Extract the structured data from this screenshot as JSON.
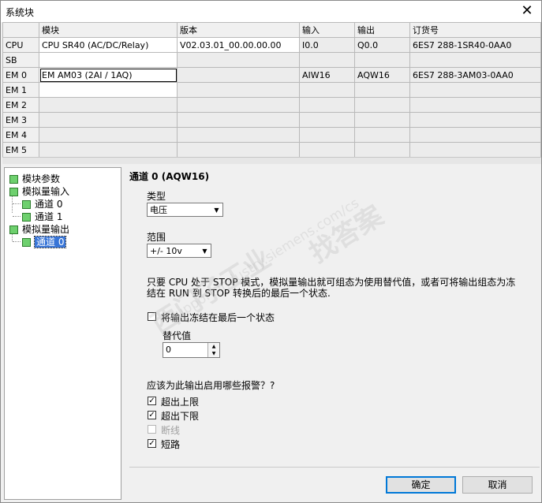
{
  "window": {
    "title": "系统块",
    "close_glyph": "✕"
  },
  "grid": {
    "headers": [
      "",
      "模块",
      "版本",
      "输入",
      "输出",
      "订货号"
    ],
    "rows": [
      {
        "slot": "CPU",
        "module": "CPU SR40 (AC/DC/Relay)",
        "version": "V02.03.01_00.00.00.00",
        "input": "I0.0",
        "output": "Q0.0",
        "order": "6ES7 288-1SR40-0AA0"
      },
      {
        "slot": "SB",
        "module": "",
        "version": "",
        "input": "",
        "output": "",
        "order": ""
      },
      {
        "slot": "EM 0",
        "module": "EM AM03 (2AI / 1AQ)",
        "version": "",
        "input": "AIW16",
        "output": "AQW16",
        "order": "6ES7 288-3AM03-0AA0"
      },
      {
        "slot": "EM 1",
        "module": "",
        "version": "",
        "input": "",
        "output": "",
        "order": ""
      },
      {
        "slot": "EM 2",
        "module": "",
        "version": "",
        "input": "",
        "output": "",
        "order": ""
      },
      {
        "slot": "EM 3",
        "module": "",
        "version": "",
        "input": "",
        "output": "",
        "order": ""
      },
      {
        "slot": "EM 4",
        "module": "",
        "version": "",
        "input": "",
        "output": "",
        "order": ""
      },
      {
        "slot": "EM 5",
        "module": "",
        "version": "",
        "input": "",
        "output": "",
        "order": ""
      }
    ]
  },
  "tree": {
    "module_params": "模块参数",
    "analog_input": "模拟量输入",
    "ai_ch0": "通道 0",
    "ai_ch1": "通道 1",
    "analog_output": "模拟量输出",
    "ao_ch0": "通道 0"
  },
  "panel": {
    "channel_title": "通道 0 (AQW16)",
    "type_label": "类型",
    "type_value": "电压",
    "range_label": "范围",
    "range_value": "+/- 10v",
    "description": "只要 CPU 处于 STOP 模式，模拟量输出就可组态为使用替代值，或者可将输出组态为冻结在 RUN 到 STOP 转换后的最后一个状态.",
    "freeze_label": "将输出冻结在最后一个状态",
    "freeze_checked": false,
    "substitute_label": "替代值",
    "substitute_value": "0",
    "alarms_question": "应该为此输出启用哪些报警？?",
    "alarm_upper": "超出上限",
    "alarm_upper_checked": true,
    "alarm_lower": "超出下限",
    "alarm_lower_checked": true,
    "alarm_wirebreak": "断线",
    "alarm_wirebreak_checked": false,
    "alarm_short": "短路",
    "alarm_short_checked": true,
    "ok": "确定",
    "cancel": "取消"
  },
  "watermark": {
    "text1": "西门子工业",
    "text2": "找答案",
    "text3": "support.industry.siemens.com/cs"
  }
}
